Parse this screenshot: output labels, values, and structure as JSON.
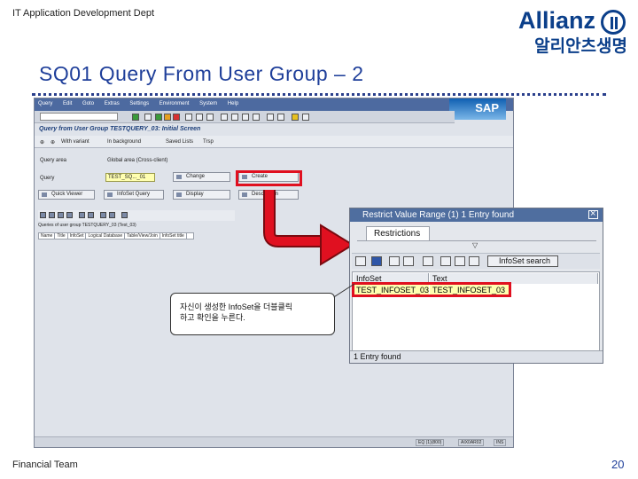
{
  "header": {
    "dept": "IT Application Development Dept",
    "brand_en": "Allianz",
    "brand_kr": "알리안츠생명",
    "title": "SQ01 Query From User Group – 2"
  },
  "sap": {
    "menu": [
      "Query",
      "Edit",
      "Goto",
      "Extras",
      "Settings",
      "Environment",
      "System",
      "Help"
    ],
    "brand": "SAP",
    "screen_title": "Query from User Group TESTQUERY_03: Initial Screen",
    "toolbar2": {
      "with_variant": "With variant",
      "in_background": "In background",
      "saved_lists": "Saved Lists",
      "transport": "Trsp"
    },
    "query_area_label": "Query area",
    "query_area_value": "Global area (Cross-client)",
    "query_label": "Query",
    "query_value": "TEST_SQ..._01",
    "buttons": {
      "change": "Change",
      "create": "Create",
      "display": "Display",
      "description": "Description",
      "quick_viewer": "Quick Viewer",
      "infoset_query": "InfoSet Query"
    },
    "alv_info": "Queries of user group   TESTQUERY_03 (Test_03)",
    "alv_columns": [
      "Name",
      "Title",
      "InfoSet",
      "Logical Database",
      "Table/View/Join",
      "InfoSet title"
    ],
    "status_cells": [
      "EQ (1)(800)",
      "AIX0AR02",
      "INS"
    ]
  },
  "dialog": {
    "title": "Restrict Value Range (1)   1 Entry found",
    "tab": "Restrictions",
    "search_label": "InfoSet search",
    "col_infoset": "InfoSet",
    "col_text": "Text",
    "row_infoset": "TEST_INFOSET_03",
    "row_text": "TEST_INFOSET_03",
    "status": "1 Entry found"
  },
  "callout": {
    "line1": "자신이 생성한 InfoSet을 더블클릭",
    "line2": "하고 확인을 누른다."
  },
  "footer": {
    "team": "Financial Team",
    "page": "20"
  },
  "colors": {
    "brand_blue": "#0b3f8a",
    "highlight_red": "#e01020",
    "arrow_red": "#e01020"
  }
}
